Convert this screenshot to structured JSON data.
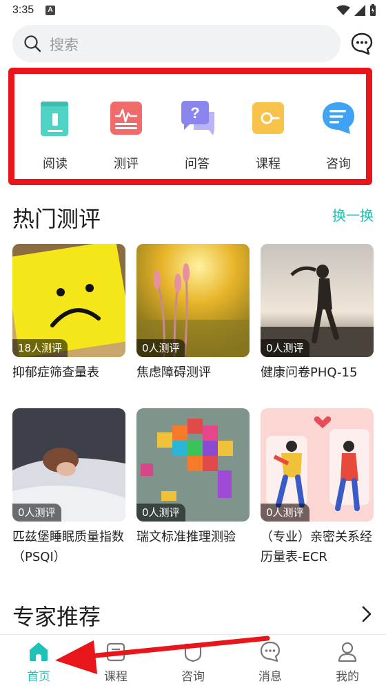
{
  "status_bar": {
    "time": "3:35",
    "notification": "A"
  },
  "search": {
    "placeholder": "搜索"
  },
  "categories": [
    {
      "label": "阅读",
      "icon": "book-icon",
      "color": "#4fd3c4"
    },
    {
      "label": "测评",
      "icon": "assessment-icon",
      "color": "#f26b6b"
    },
    {
      "label": "问答",
      "icon": "qa-icon",
      "color": "#8a86ee"
    },
    {
      "label": "课程",
      "icon": "course-icon",
      "color": "#f7c34a"
    },
    {
      "label": "咨询",
      "icon": "consult-icon",
      "color": "#3fa2f2"
    }
  ],
  "hot_section": {
    "title": "热门测评",
    "action": "换一换"
  },
  "cards": [
    {
      "badge": "18人测评",
      "title": "抑郁症筛查量表"
    },
    {
      "badge": "0人测评",
      "title": "焦虑障碍测评"
    },
    {
      "badge": "0人测评",
      "title": "健康问卷PHQ-15"
    },
    {
      "badge": "0人测评",
      "title": "匹兹堡睡眠质量指数（PSQI）"
    },
    {
      "badge": "0人测评",
      "title": "瑞文标准推理测验"
    },
    {
      "badge": "0人测评",
      "title": "（专业）亲密关系经历量表-ECR"
    }
  ],
  "expert_section": {
    "title": "专家推荐"
  },
  "bottom_nav": [
    {
      "label": "首页",
      "icon": "home-icon",
      "active": true
    },
    {
      "label": "课程",
      "icon": "course-tab-icon"
    },
    {
      "label": "咨询",
      "icon": "consult-tab-icon"
    },
    {
      "label": "消息",
      "icon": "message-icon"
    },
    {
      "label": "我的",
      "icon": "profile-icon"
    }
  ],
  "colors": {
    "accent": "#21c2b6",
    "highlight": "#e8151b"
  }
}
